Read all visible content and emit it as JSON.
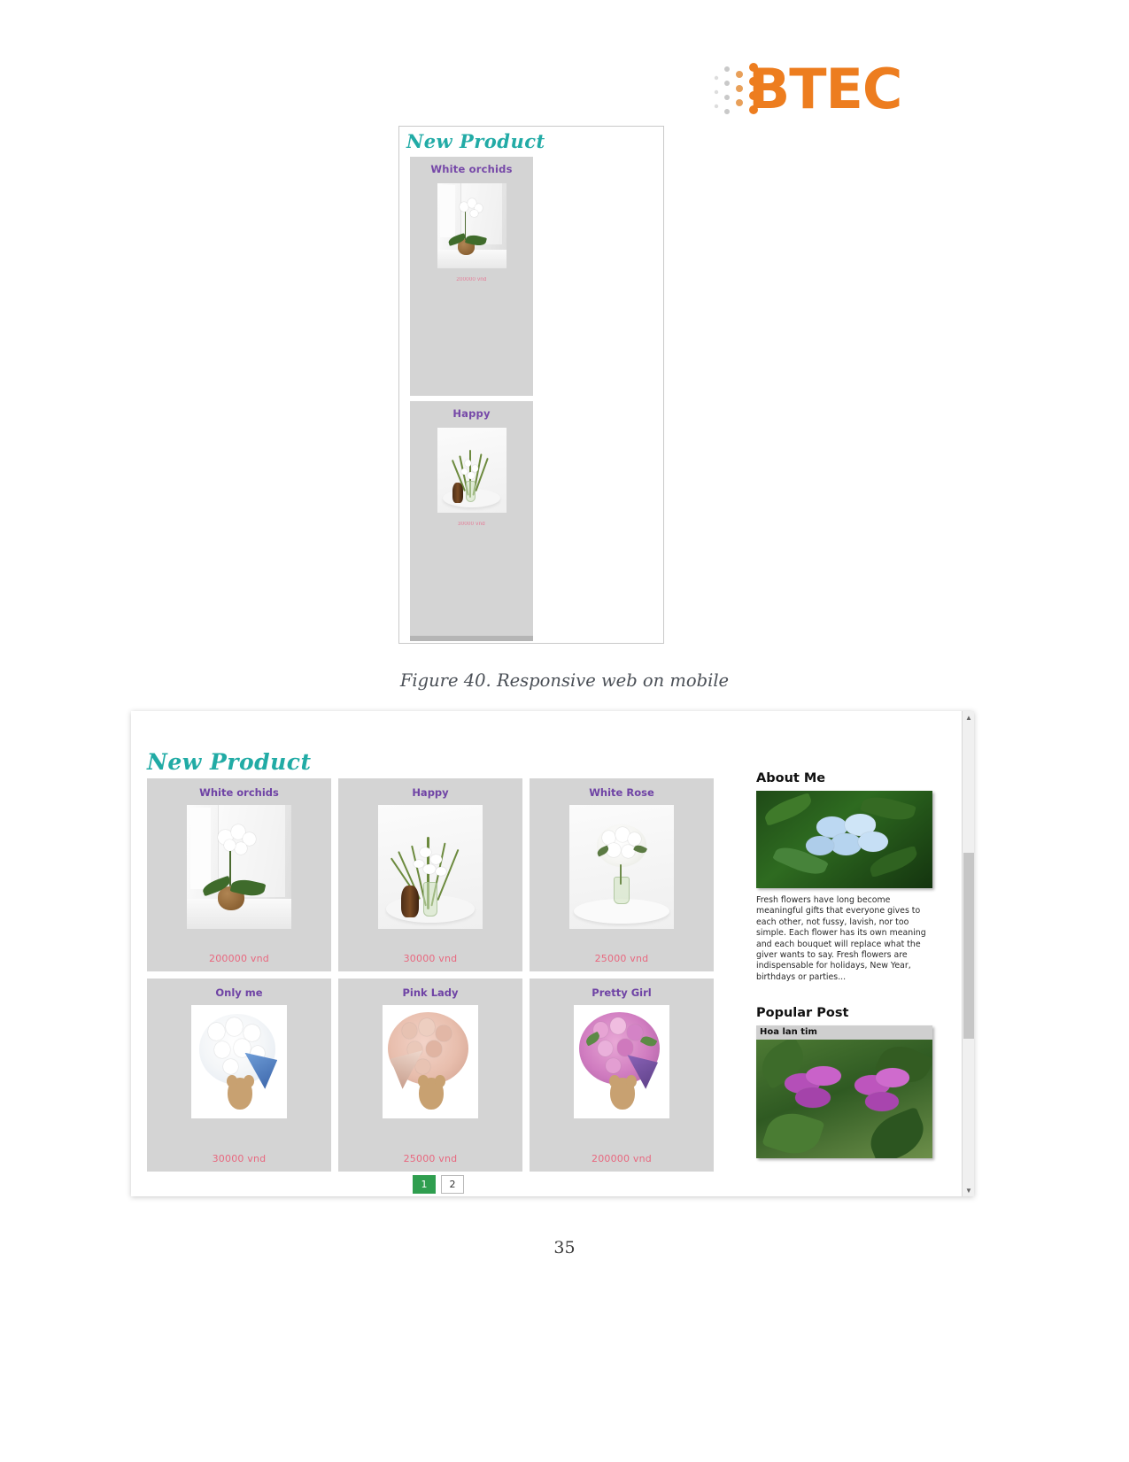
{
  "logo": {
    "text": "BTEC",
    "color": "#ED7D1F"
  },
  "figure_mobile": {
    "heading": "New Product",
    "cards": [
      {
        "title": "White orchids",
        "price": "200000 vnd"
      },
      {
        "title": "Happy",
        "price": "30000 vnd"
      }
    ]
  },
  "caption": "Figure 40. Responsive web on mobile",
  "figure_desktop": {
    "heading": "New Product",
    "products": [
      {
        "title": "White orchids",
        "price": "200000 vnd"
      },
      {
        "title": "Happy",
        "price": "30000 vnd"
      },
      {
        "title": "White Rose",
        "price": "25000 vnd"
      },
      {
        "title": "Only me",
        "price": "30000 vnd"
      },
      {
        "title": "Pink Lady",
        "price": "25000 vnd"
      },
      {
        "title": "Pretty Girl",
        "price": "200000 vnd"
      }
    ],
    "pagination": {
      "pages": [
        "1",
        "2"
      ],
      "active": "1"
    },
    "sidebar": {
      "about_heading": "About Me",
      "about_text": "Fresh flowers have long become meaningful gifts that everyone gives to each other, not fussy, lavish, nor too simple. Each flower has its own meaning and each bouquet will replace what the giver wants to say. Fresh flowers are indispensable for holidays, New Year, birthdays or parties...",
      "popular_heading": "Popular Post",
      "popular_post_title": "Hoa lan tim"
    },
    "scrollbar": {
      "up": "▲",
      "down": "▼"
    }
  },
  "page_number": "35",
  "colors": {
    "heading_teal": "#21ABA5",
    "product_title_purple": "#6f43a5",
    "price_pink": "#e8687f",
    "card_gray": "#d4d4d4",
    "pagination_active": "#2f9e4f"
  }
}
